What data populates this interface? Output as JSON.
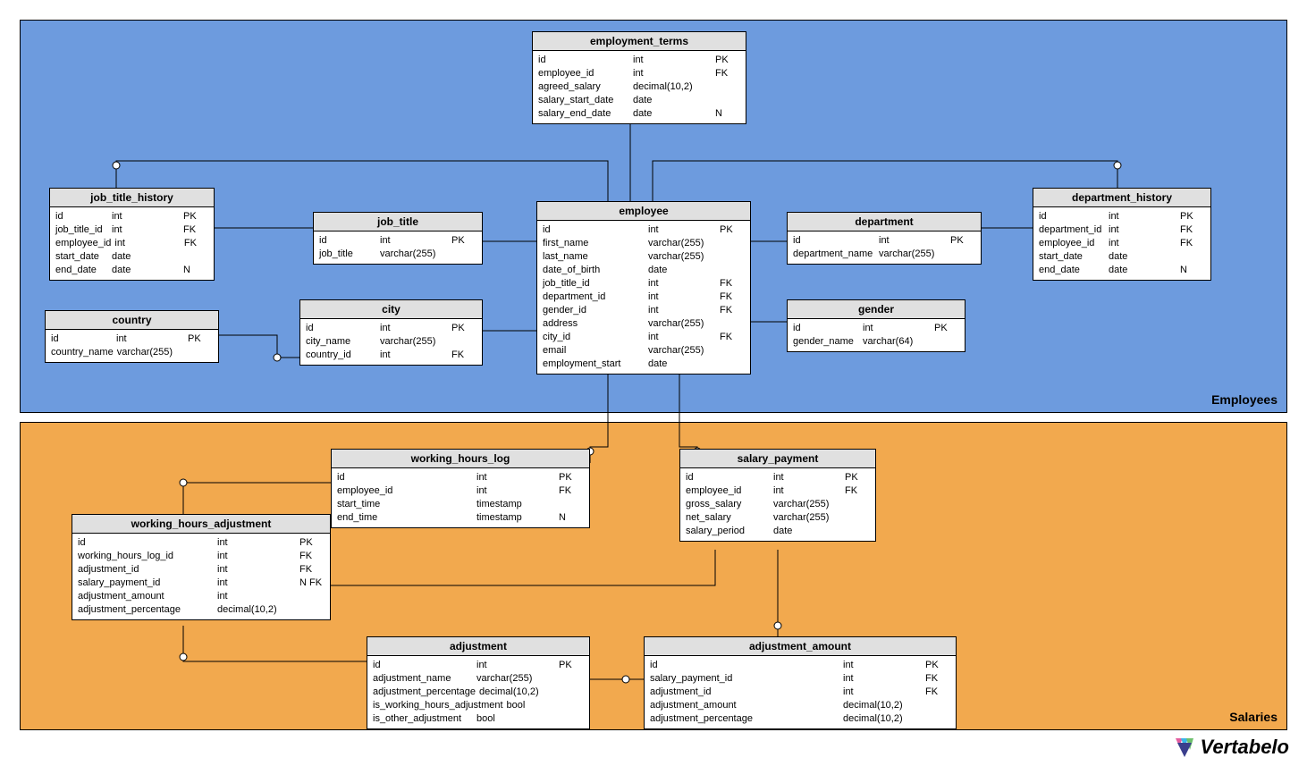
{
  "regions": {
    "employees": {
      "label": "Employees",
      "color": "#6d9bde"
    },
    "salaries": {
      "label": "Salaries",
      "color": "#f2a94e"
    }
  },
  "logo": "Vertabelo",
  "tables": {
    "employment_terms": {
      "title": "employment_terms",
      "cols": [
        {
          "name": "id",
          "type": "int",
          "key": "PK"
        },
        {
          "name": "employee_id",
          "type": "int",
          "key": "FK"
        },
        {
          "name": "agreed_salary",
          "type": "decimal(10,2)",
          "key": ""
        },
        {
          "name": "salary_start_date",
          "type": "date",
          "key": ""
        },
        {
          "name": "salary_end_date",
          "type": "date",
          "key": "N"
        }
      ]
    },
    "job_title_history": {
      "title": "job_title_history",
      "cols": [
        {
          "name": "id",
          "type": "int",
          "key": "PK"
        },
        {
          "name": "job_title_id",
          "type": "int",
          "key": "FK"
        },
        {
          "name": "employee_id",
          "type": "int",
          "key": "FK"
        },
        {
          "name": "start_date",
          "type": "date",
          "key": ""
        },
        {
          "name": "end_date",
          "type": "date",
          "key": "N"
        }
      ]
    },
    "job_title": {
      "title": "job_title",
      "cols": [
        {
          "name": "id",
          "type": "int",
          "key": "PK"
        },
        {
          "name": "job_title",
          "type": "varchar(255)",
          "key": ""
        }
      ]
    },
    "employee": {
      "title": "employee",
      "cols": [
        {
          "name": "id",
          "type": "int",
          "key": "PK"
        },
        {
          "name": "first_name",
          "type": "varchar(255)",
          "key": ""
        },
        {
          "name": "last_name",
          "type": "varchar(255)",
          "key": ""
        },
        {
          "name": "date_of_birth",
          "type": "date",
          "key": ""
        },
        {
          "name": "job_title_id",
          "type": "int",
          "key": "FK"
        },
        {
          "name": "department_id",
          "type": "int",
          "key": "FK"
        },
        {
          "name": "gender_id",
          "type": "int",
          "key": "FK"
        },
        {
          "name": "address",
          "type": "varchar(255)",
          "key": ""
        },
        {
          "name": "city_id",
          "type": "int",
          "key": "FK"
        },
        {
          "name": "email",
          "type": "varchar(255)",
          "key": ""
        },
        {
          "name": "employment_start",
          "type": "date",
          "key": ""
        }
      ]
    },
    "department": {
      "title": "department",
      "cols": [
        {
          "name": "id",
          "type": "int",
          "key": "PK"
        },
        {
          "name": "department_name",
          "type": "varchar(255)",
          "key": ""
        }
      ]
    },
    "department_history": {
      "title": "department_history",
      "cols": [
        {
          "name": "id",
          "type": "int",
          "key": "PK"
        },
        {
          "name": "department_id",
          "type": "int",
          "key": "FK"
        },
        {
          "name": "employee_id",
          "type": "int",
          "key": "FK"
        },
        {
          "name": "start_date",
          "type": "date",
          "key": ""
        },
        {
          "name": "end_date",
          "type": "date",
          "key": "N"
        }
      ]
    },
    "country": {
      "title": "country",
      "cols": [
        {
          "name": "id",
          "type": "int",
          "key": "PK"
        },
        {
          "name": "country_name",
          "type": "varchar(255)",
          "key": ""
        }
      ]
    },
    "city": {
      "title": "city",
      "cols": [
        {
          "name": "id",
          "type": "int",
          "key": "PK"
        },
        {
          "name": "city_name",
          "type": "varchar(255)",
          "key": ""
        },
        {
          "name": "country_id",
          "type": "int",
          "key": "FK"
        }
      ]
    },
    "gender": {
      "title": "gender",
      "cols": [
        {
          "name": "id",
          "type": "int",
          "key": "PK"
        },
        {
          "name": "gender_name",
          "type": "varchar(64)",
          "key": ""
        }
      ]
    },
    "working_hours_log": {
      "title": "working_hours_log",
      "cols": [
        {
          "name": "id",
          "type": "int",
          "key": "PK"
        },
        {
          "name": "employee_id",
          "type": "int",
          "key": "FK"
        },
        {
          "name": "start_time",
          "type": "timestamp",
          "key": ""
        },
        {
          "name": "end_time",
          "type": "timestamp",
          "key": "N"
        }
      ]
    },
    "salary_payment": {
      "title": "salary_payment",
      "cols": [
        {
          "name": "id",
          "type": "int",
          "key": "PK"
        },
        {
          "name": "employee_id",
          "type": "int",
          "key": "FK"
        },
        {
          "name": "gross_salary",
          "type": "varchar(255)",
          "key": ""
        },
        {
          "name": "net_salary",
          "type": "varchar(255)",
          "key": ""
        },
        {
          "name": "salary_period",
          "type": "date",
          "key": ""
        }
      ]
    },
    "working_hours_adjustment": {
      "title": "working_hours_adjustment",
      "cols": [
        {
          "name": "id",
          "type": "int",
          "key": "PK"
        },
        {
          "name": "working_hours_log_id",
          "type": "int",
          "key": "FK"
        },
        {
          "name": "adjustment_id",
          "type": "int",
          "key": "FK"
        },
        {
          "name": "salary_payment_id",
          "type": "int",
          "key": "N FK"
        },
        {
          "name": "adjustment_amount",
          "type": "int",
          "key": ""
        },
        {
          "name": "adjustment_percentage",
          "type": "decimal(10,2)",
          "key": ""
        }
      ]
    },
    "adjustment": {
      "title": "adjustment",
      "cols": [
        {
          "name": "id",
          "type": "int",
          "key": "PK"
        },
        {
          "name": "adjustment_name",
          "type": "varchar(255)",
          "key": ""
        },
        {
          "name": "adjustment_percentage",
          "type": "decimal(10,2)",
          "key": ""
        },
        {
          "name": "is_working_hours_adjustment",
          "type": "bool",
          "key": ""
        },
        {
          "name": "is_other_adjustment",
          "type": "bool",
          "key": ""
        }
      ]
    },
    "adjustment_amount": {
      "title": "adjustment_amount",
      "cols": [
        {
          "name": "id",
          "type": "int",
          "key": "PK"
        },
        {
          "name": "salary_payment_id",
          "type": "int",
          "key": "FK"
        },
        {
          "name": "adjustment_id",
          "type": "int",
          "key": "FK"
        },
        {
          "name": "adjustment_amount",
          "type": "decimal(10,2)",
          "key": ""
        },
        {
          "name": "adjustment_percentage",
          "type": "decimal(10,2)",
          "key": ""
        }
      ]
    }
  }
}
